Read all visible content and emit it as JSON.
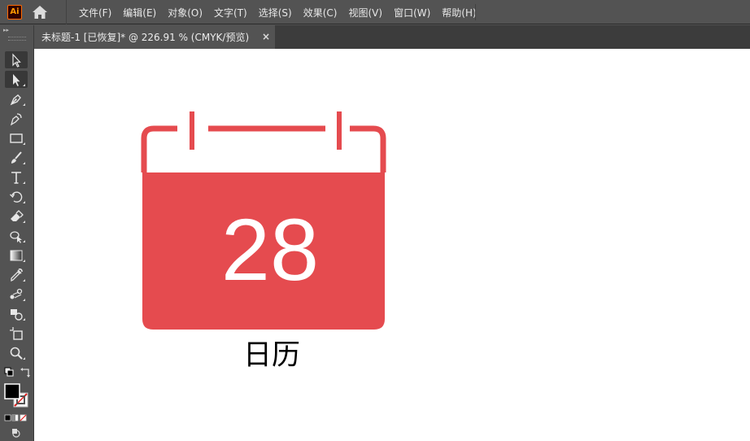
{
  "app": {
    "logo_text": "Ai"
  },
  "menu": {
    "items": [
      "文件(F)",
      "编辑(E)",
      "对象(O)",
      "文字(T)",
      "选择(S)",
      "效果(C)",
      "视图(V)",
      "窗口(W)",
      "帮助(H)"
    ]
  },
  "document_tab": {
    "title": "未标题-1 [已恢复]* @ 226.91 % (CMYK/预览)",
    "close_glyph": "×"
  },
  "tools": [
    {
      "name": "selection-tool-icon"
    },
    {
      "name": "direct-selection-tool-icon"
    },
    {
      "name": "pen-tool-icon"
    },
    {
      "name": "curvature-tool-icon"
    },
    {
      "name": "rectangle-tool-icon"
    },
    {
      "name": "paintbrush-tool-icon"
    },
    {
      "name": "type-tool-icon"
    },
    {
      "name": "rotate-tool-icon"
    },
    {
      "name": "eraser-tool-icon"
    },
    {
      "name": "shape-builder-tool-icon"
    },
    {
      "name": "gradient-tool-icon"
    },
    {
      "name": "eyedropper-tool-icon"
    },
    {
      "name": "blend-tool-icon"
    },
    {
      "name": "live-paint-tool-icon"
    },
    {
      "name": "artboard-tool-icon"
    },
    {
      "name": "zoom-tool-icon"
    }
  ],
  "artwork": {
    "calendar_day": "28",
    "calendar_label": "日历",
    "accent_color": "#E54B4F"
  },
  "colors": {
    "ui_background": "#535353",
    "tab_bar": "#3C3C3C",
    "canvas": "#FFFFFF",
    "fill_swatch": "#000000",
    "stroke_swatch": "none"
  }
}
